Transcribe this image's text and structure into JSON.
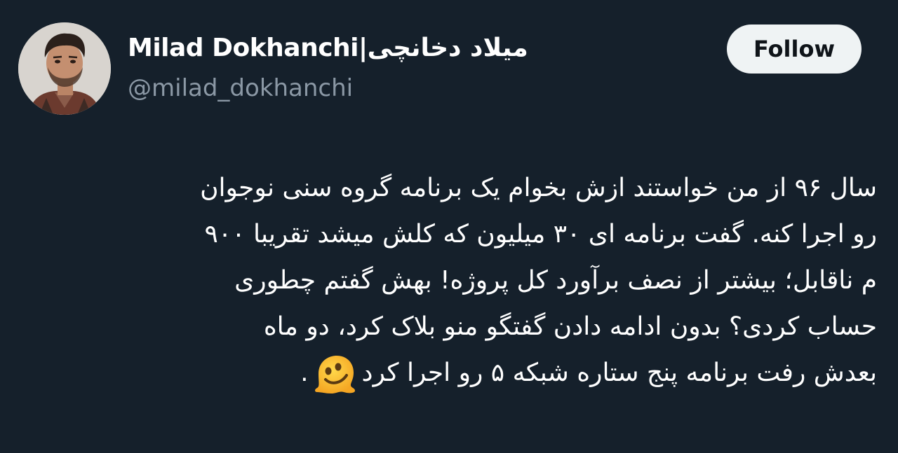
{
  "author": {
    "display_name": "Milad Dokhanchi|میلاد دخانچی",
    "handle": "@milad_dokhanchi"
  },
  "actions": {
    "follow_label": "Follow"
  },
  "tweet": {
    "lines": [
      "سال ۹۶ از من خواستند ازش بخوام یک برنامه گروه سنی نوجوان",
      "رو اجرا کنه. گفت برنامه ای ۳۰ میلیون که کلش میشد  تقریبا ۹۰۰",
      "م ناقابل؛ بیشتر از نصف برآورد کل پروژه! بهش گفتم چطوری",
      "حساب کردی؟ بدون ادامه دادن گفتگو منو بلاک کرد، دو ماه",
      "بعدش رفت برنامه پنج ستاره شبکه ۵ رو اجرا کرد"
    ],
    "trailing_period": ".",
    "emoji": "melting-face-emoji"
  },
  "colors": {
    "background": "#15202b",
    "text_primary": "#ffffff",
    "text_secondary": "#8b98a5",
    "button_bg": "#eff3f4",
    "button_text": "#0f1419"
  }
}
